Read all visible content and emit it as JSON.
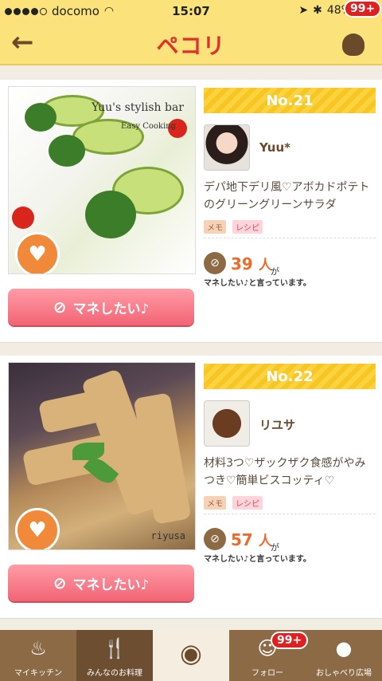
{
  "status_bar": {
    "carrier": "docomo",
    "time": "15:07",
    "battery": "48%"
  },
  "header": {
    "logo": "ペコリ",
    "notification_badge": "99+"
  },
  "cards": [
    {
      "rank": "No.21",
      "photo_caption_title": "Yuu's stylish bar",
      "photo_caption_sub": "Easy Cooking",
      "user": "Yuu*",
      "description": "デパ地下デリ風♡アボカドポテトのグリーングリーンサラダ",
      "tags": [
        "メモ",
        "レシピ"
      ],
      "count": "39",
      "unit": "人",
      "count_suffix": "が",
      "saying": "マネしたい♪と言っています。",
      "button": "マネしたい♪"
    },
    {
      "rank": "No.22",
      "photo_caption_title": "riyusa",
      "user": "リユサ",
      "description": "材料3つ♡ザックザク食感がやみつき♡簡単ビスコッティ♡",
      "tags": [
        "メモ",
        "レシピ"
      ],
      "count": "57",
      "unit": "人",
      "count_suffix": "が",
      "saying": "マネしたい♪と言っています。",
      "button": "マネしたい♪"
    }
  ],
  "tabbar": {
    "items": [
      {
        "label": "マイキッチン",
        "icon": "pot-icon"
      },
      {
        "label": "みんなのお料理",
        "icon": "fork-knife-icon"
      },
      {
        "label": "",
        "icon": "camera-icon"
      },
      {
        "label": "フォロー",
        "icon": "follow-icon"
      },
      {
        "label": "おしゃべり広場",
        "icon": "chat-icon"
      }
    ],
    "follow_badge": "99+"
  }
}
